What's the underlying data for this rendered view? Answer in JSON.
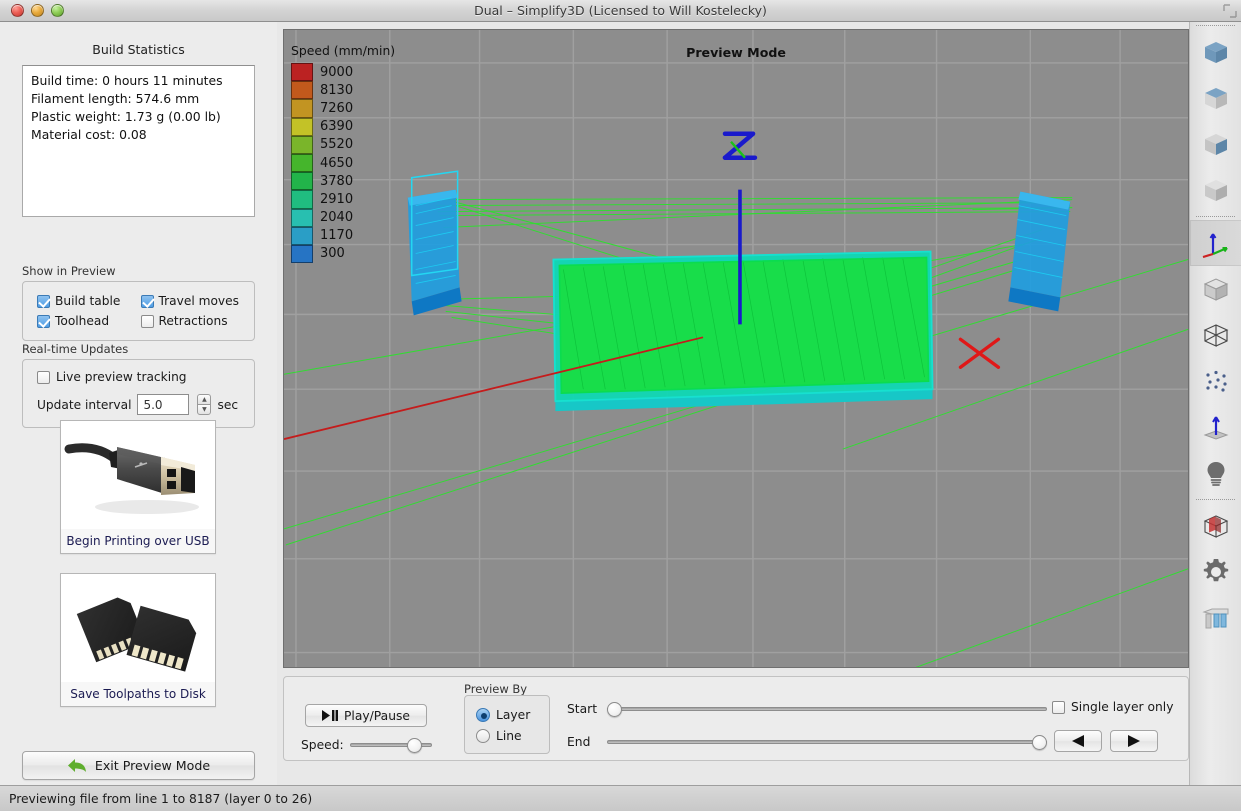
{
  "window": {
    "title": "Dual – Simplify3D (Licensed to Will Kostelecky)",
    "controls": {
      "close": "close-button",
      "minimize": "minimize-button",
      "zoom": "zoom-button"
    }
  },
  "left_panel": {
    "build_statistics": {
      "title": "Build Statistics",
      "lines": [
        "Build time: 0 hours 11 minutes",
        "Filament length: 574.6 mm",
        "Plastic weight: 1.73 g (0.00 lb)",
        "Material cost: 0.08"
      ]
    },
    "show_in_preview": {
      "label": "Show in Preview",
      "checkboxes": [
        {
          "label": "Build table",
          "checked": true
        },
        {
          "label": "Travel moves",
          "checked": true
        },
        {
          "label": "Toolhead",
          "checked": true
        },
        {
          "label": "Retractions",
          "checked": false
        }
      ]
    },
    "realtime_updates": {
      "label": "Real-time Updates",
      "live_preview": {
        "label": "Live preview tracking",
        "checked": false
      },
      "update_interval": {
        "label": "Update interval",
        "value": "5.0",
        "unit": "sec"
      }
    },
    "usb_button": {
      "caption": "Begin Printing over USB",
      "image": "usb-cable-photo"
    },
    "sd_button": {
      "caption": "Save Toolpaths to Disk",
      "image": "sd-card-photo"
    },
    "exit_button": {
      "label": "Exit Preview Mode",
      "icon": "back-arrow-icon",
      "icon_color": "#5fae2e"
    }
  },
  "viewport": {
    "title": "Preview Mode",
    "axis_labels": {
      "z": "Z",
      "z_color": "#1a1acc",
      "x_color": "#d81f1f"
    },
    "background": "#8d8d8d"
  },
  "chart_data": {
    "type": "bar",
    "title": "Speed (mm/min)",
    "xlabel": "",
    "ylabel": "Speed (mm/min)",
    "legend_position": "top-left",
    "categories": [
      "9000",
      "8130",
      "7260",
      "6390",
      "5520",
      "4650",
      "3780",
      "2910",
      "2040",
      "1170",
      "300"
    ],
    "values": [
      9000,
      8130,
      7260,
      6390,
      5520,
      4650,
      3780,
      2910,
      2040,
      1170,
      300
    ],
    "colors": [
      "#bb2222",
      "#c2591c",
      "#c29422",
      "#c3c227",
      "#7ab52a",
      "#45b52c",
      "#22b44a",
      "#20bd80",
      "#28bfb0",
      "#2a9ec6",
      "#2674c4"
    ]
  },
  "bottom_controls": {
    "play_pause": {
      "label": "Play/Pause",
      "icon": "play-pause-icon"
    },
    "speed": {
      "label": "Speed:",
      "value": 85
    },
    "preview_by": {
      "label": "Preview By",
      "options": [
        {
          "label": "Layer",
          "selected": true
        },
        {
          "label": "Line",
          "selected": false
        }
      ]
    },
    "start_slider": {
      "label": "Start",
      "value": 0
    },
    "end_slider": {
      "label": "End",
      "value": 100
    },
    "single_layer_only": {
      "label": "Single layer only",
      "checked": false
    },
    "prev_button": {
      "icon": "prev-triangle-icon",
      "glyph": "◀"
    },
    "next_button": {
      "icon": "next-triangle-icon",
      "glyph": "▶"
    }
  },
  "toolbar": {
    "items": [
      {
        "name": "view-front-cube",
        "icon": "cube-front-icon",
        "active": false
      },
      {
        "name": "view-top-cube",
        "icon": "cube-top-icon",
        "active": false
      },
      {
        "name": "view-side-cube",
        "icon": "cube-side-icon",
        "active": false
      },
      {
        "name": "view-iso-cube",
        "icon": "cube-plain-icon",
        "active": false
      },
      {
        "name": "axes-origin",
        "icon": "axes-icon",
        "active": true
      },
      {
        "name": "shaded-view",
        "icon": "solid-cube-icon",
        "active": false
      },
      {
        "name": "wireframe-view",
        "icon": "wireframe-cube-icon",
        "active": false
      },
      {
        "name": "points-view",
        "icon": "vertices-icon",
        "active": false
      },
      {
        "name": "normals-view",
        "icon": "normal-arrow-icon",
        "active": false
      },
      {
        "name": "lighting",
        "icon": "lightbulb-icon",
        "active": false
      },
      {
        "name": "cross-section",
        "icon": "cross-section-cube-icon",
        "active": false
      },
      {
        "name": "settings",
        "icon": "gear-icon",
        "active": false
      },
      {
        "name": "supports",
        "icon": "support-structure-icon",
        "active": false
      }
    ]
  },
  "status_bar": {
    "text": "Previewing file from line 1 to 8187 (layer 0 to 26)"
  }
}
